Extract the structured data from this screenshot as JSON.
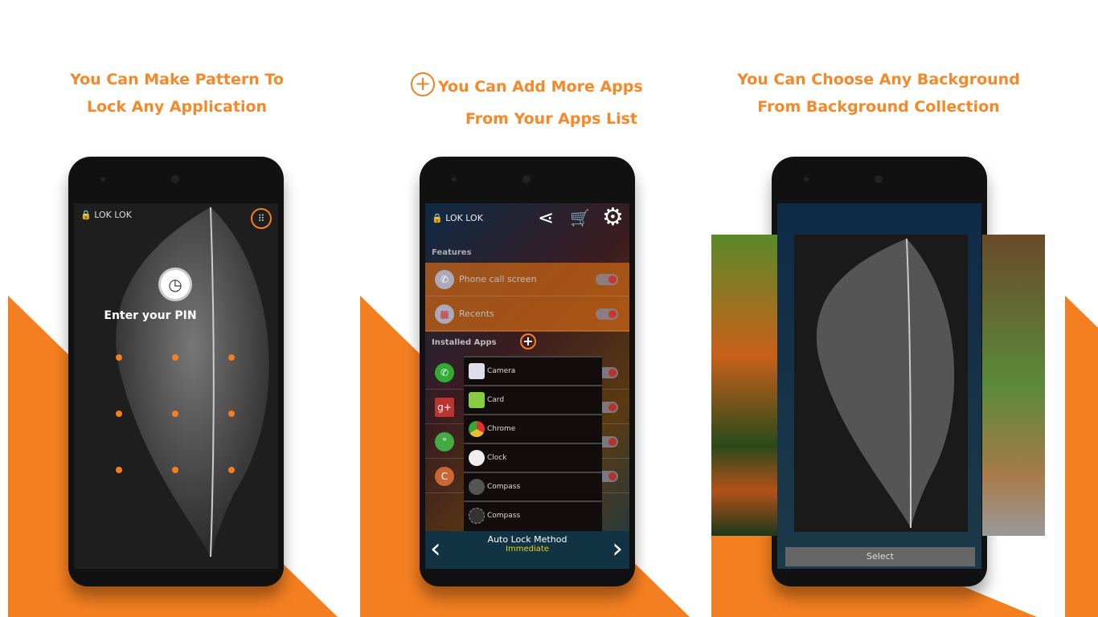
{
  "colors": {
    "accent": "#f47f20",
    "caption": "#f5892a"
  },
  "panel1": {
    "caption_line1": "You Can Make Pattern To",
    "caption_line2": "Lock Any Application",
    "logo": "LOK LOK",
    "pin_prompt": "Enter your PIN",
    "icons": [
      "lock-icon",
      "keypad-icon",
      "clock-icon"
    ]
  },
  "panel2": {
    "caption_line1": "You Can Add More Apps",
    "caption_line2": "From Your Apps List",
    "logo": "LOK LOK",
    "features_header": "Features",
    "features": [
      {
        "label": "Phone call screen",
        "icon": "phone-icon"
      },
      {
        "label": "Recents",
        "icon": "grid-icon"
      }
    ],
    "installed_header": "Installed Apps",
    "installed_icons": [
      "whatsapp-icon",
      "google-plus-icon",
      "hangouts-icon",
      "chat-icon"
    ],
    "popup_apps": [
      "Camera",
      "Card",
      "Chrome",
      "Clock",
      "Compass",
      "Compass"
    ],
    "bottom_title": "Auto Lock Method",
    "bottom_value": "Immediate"
  },
  "panel3": {
    "caption_line1": "You Can Choose Any Background",
    "caption_line2": "From Background Collection",
    "select_label": "Select"
  }
}
